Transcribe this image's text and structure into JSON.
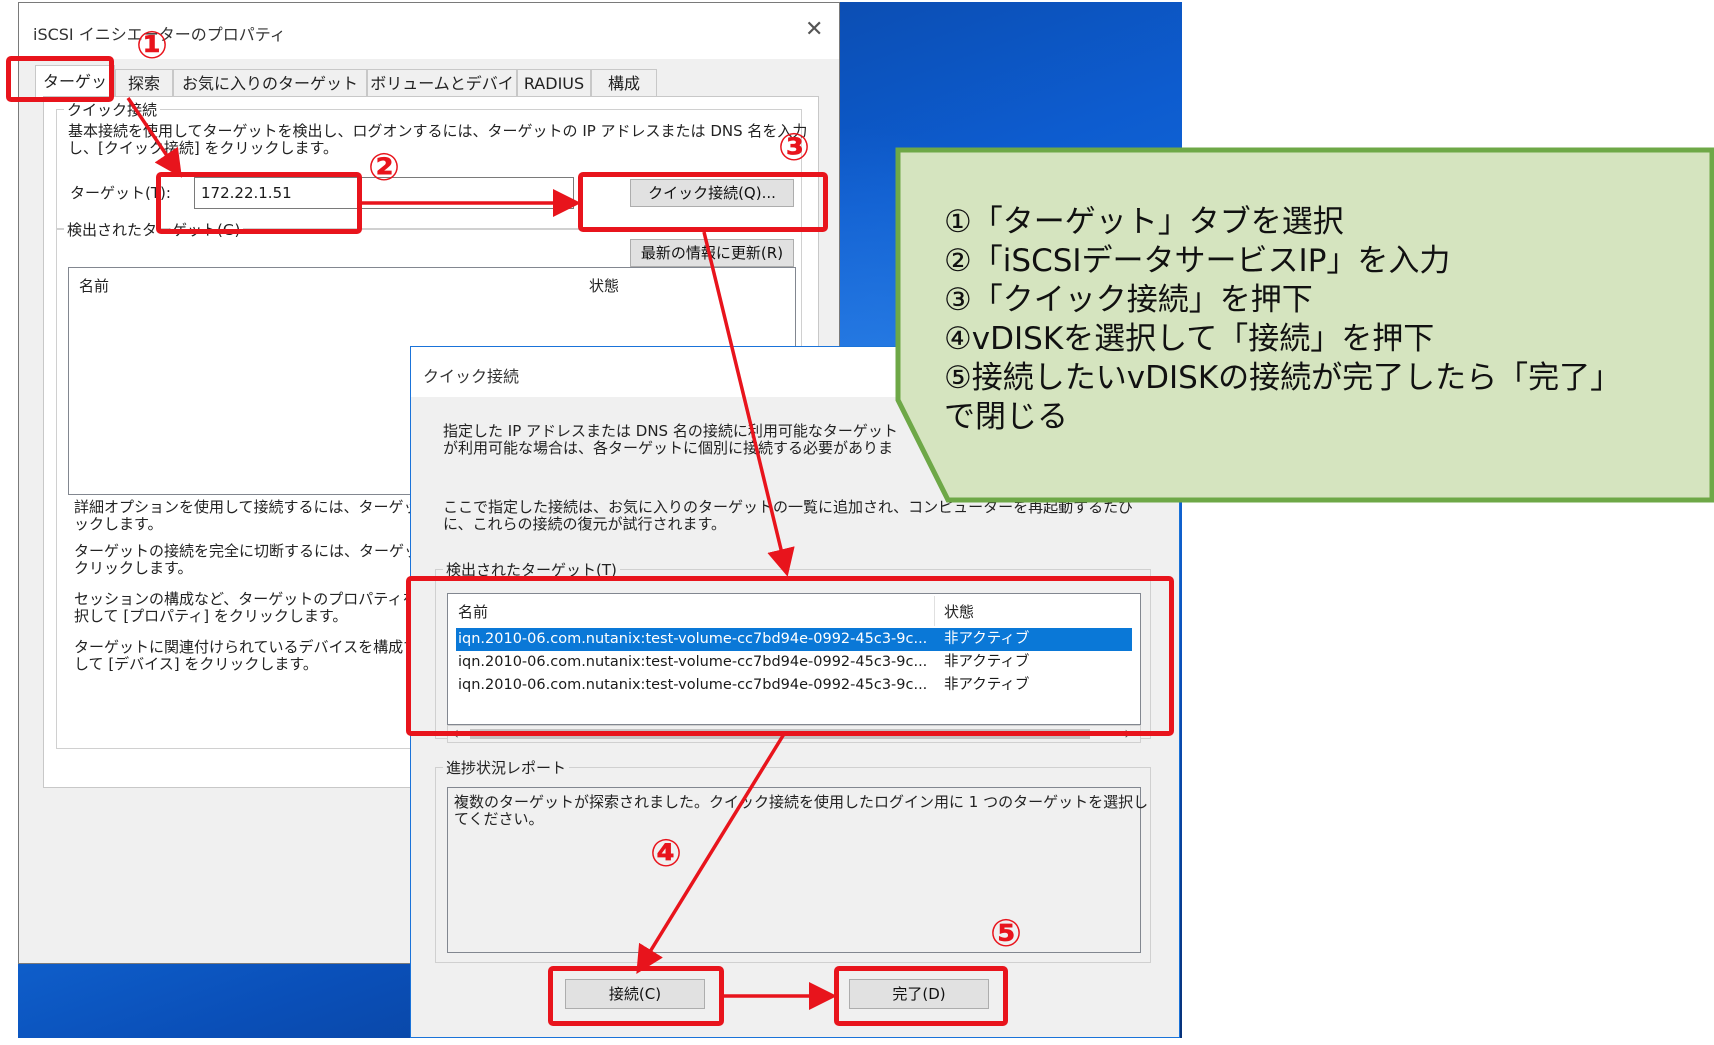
{
  "main_window": {
    "title": "iSCSI イニシエーターのプロパティ",
    "close_glyph": "✕",
    "tabs": [
      "ターゲット",
      "探索",
      "お気に入りのターゲット",
      "ボリュームとデバイス",
      "RADIUS",
      "構成"
    ],
    "quick_connect_group": {
      "legend": "クイック接続",
      "description_line1": "基本接続を使用してターゲットを検出し、ログオンするには、ターゲットの IP アドレスまたは DNS 名を入力",
      "description_line2": "し、[クイック接続] をクリックします。",
      "target_label": "ターゲット(T):",
      "target_value": "172.22.1.51",
      "quick_connect_button": "クイック接続(Q)..."
    },
    "discovered_group": {
      "legend": "検出されたターゲット(G)",
      "refresh_button": "最新の情報に更新(R)",
      "col_name": "名前",
      "col_status": "状態"
    },
    "help_texts": [
      [
        "詳細オプションを使用して接続するには、ターゲットを",
        "ックします。"
      ],
      [
        "ターゲットの接続を完全に切断するには、ターゲット",
        "クリックします。"
      ],
      [
        "セッションの構成など、ターゲットのプロパティを確認",
        "択して [プロパティ] をクリックします。"
      ],
      [
        "ターゲットに関連付けられているデバイスを構成する",
        "して [デバイス] をクリックします。"
      ]
    ]
  },
  "quick_dialog": {
    "title": "クイック接続",
    "info1_line1": "指定した IP アドレスまたは DNS 名の接続に利用可能なターゲット",
    "info1_line2": "が利用可能な場合は、各ターゲットに個別に接続する必要がありま",
    "info2_line1": "ここで指定した接続は、お気に入りのターゲットの一覧に追加され、コンピューターを再起動するたび",
    "info2_line2": "に、これらの接続の復元が試行されます。",
    "targets_legend": "検出されたターゲット(T)",
    "col_name": "名前",
    "col_status": "状態",
    "rows": [
      {
        "name": "iqn.2010-06.com.nutanix:test-volume-cc7bd94e-0992-45c3-9c...",
        "status": "非アクティブ",
        "selected": true
      },
      {
        "name": "iqn.2010-06.com.nutanix:test-volume-cc7bd94e-0992-45c3-9c...",
        "status": "非アクティブ",
        "selected": false
      },
      {
        "name": "iqn.2010-06.com.nutanix:test-volume-cc7bd94e-0992-45c3-9c...",
        "status": "非アクティブ",
        "selected": false
      }
    ],
    "scroll_left": "‹",
    "scroll_right": "›",
    "progress_legend": "進捗状況レポート",
    "progress_line1": "複数のターゲットが探索されました。クイック接続を使用したログイン用に 1 つのターゲットを選択し",
    "progress_line2": "てください。",
    "connect_button": "接続(C)",
    "done_button": "完了(D)"
  },
  "markers": [
    "①",
    "②",
    "③",
    "④",
    "⑤"
  ],
  "callout": {
    "steps": [
      "①「ターゲット」タブを選択",
      "②「iSCSIデータサービスIP」を入力",
      "③「クイック接続」を押下",
      "④vDISKを選択して「接続」を押下",
      "⑤接続したいvDISKの接続が完了したら「完了」",
      "で閉じる"
    ]
  },
  "colors": {
    "annotation_red": "#e8141c",
    "callout_fill": "#d5e4bf",
    "callout_border": "#6ea847",
    "selection": "#0a78d7"
  }
}
